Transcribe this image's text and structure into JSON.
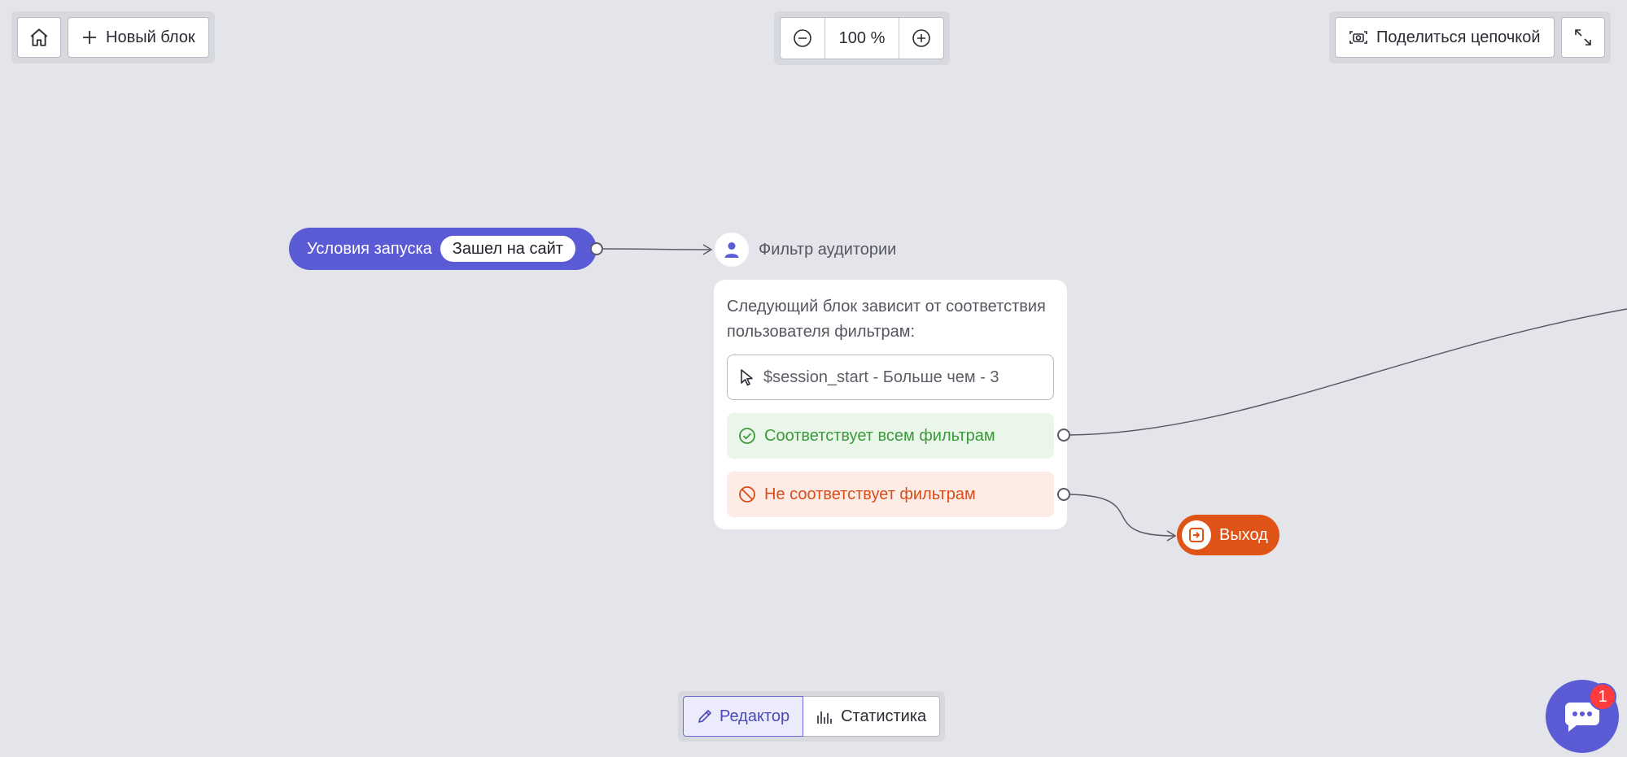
{
  "toolbar_left": {
    "home_icon": "home-icon",
    "new_block_label": "Новый блок"
  },
  "zoom": {
    "value": "100 %",
    "zoom_out_icon": "minus-circle-icon",
    "zoom_in_icon": "plus-circle-icon"
  },
  "toolbar_right": {
    "share_label": "Поделиться цепочкой",
    "share_icon": "camera-icon",
    "fullscreen_icon": "expand-icon"
  },
  "start_node": {
    "label": "Условия запуска",
    "trigger": "Зашел на сайт"
  },
  "filter_node": {
    "title": "Фильтр аудитории",
    "description": "Следующий блок зависит от соответствия пользователя фильтрам:",
    "condition": "$session_start - Больше чем - 3",
    "match_label": "Соответствует всем фильтрам",
    "no_match_label": "Не соответствует фильтрам"
  },
  "exit_node": {
    "label": "Выход"
  },
  "tabs": [
    {
      "label": "Редактор",
      "active": true
    },
    {
      "label": "Статистика",
      "active": false
    }
  ],
  "chat": {
    "badge_count": "1"
  },
  "colors": {
    "background": "#e4e5ea",
    "accent": "#5b5bd6",
    "success": "#3b9a3b",
    "danger": "#e05317",
    "badge": "#ff3b3b"
  }
}
